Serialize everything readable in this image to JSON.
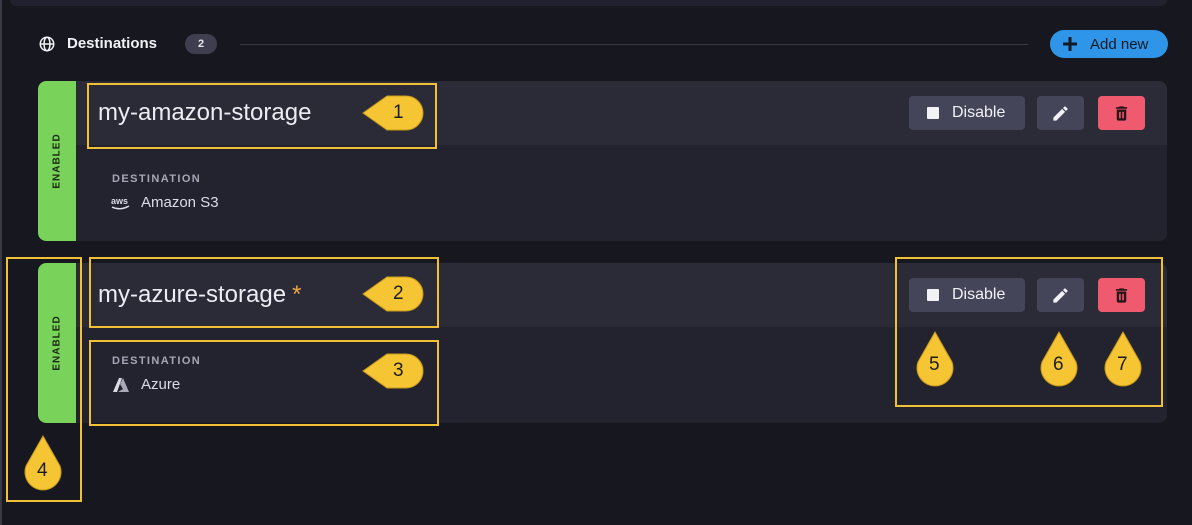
{
  "section": {
    "title": "Destinations",
    "count": "2",
    "add_button_label": "Add new",
    "icon": "globe-icon"
  },
  "cards": [
    {
      "name": "my-amazon-storage",
      "status": "ENABLED",
      "status_color": "#79d25a",
      "modified_marker": "",
      "destination_label": "DESTINATION",
      "destination_value": "Amazon S3",
      "destination_icon": "aws-icon",
      "disable_label": "Disable"
    },
    {
      "name": "my-azure-storage",
      "status": "ENABLED",
      "status_color": "#79d25a",
      "modified_marker": "*",
      "destination_label": "DESTINATION",
      "destination_value": "Azure",
      "destination_icon": "azure-icon",
      "disable_label": "Disable"
    }
  ],
  "callouts": [
    "1",
    "2",
    "3",
    "4",
    "5",
    "6",
    "7"
  ],
  "colors": {
    "background": "#17171f",
    "card": "#23232f",
    "card_header": "#2b2b38",
    "accent_blue": "#2f95e8",
    "danger": "#ef5a6e",
    "highlight": "#f1c037"
  }
}
